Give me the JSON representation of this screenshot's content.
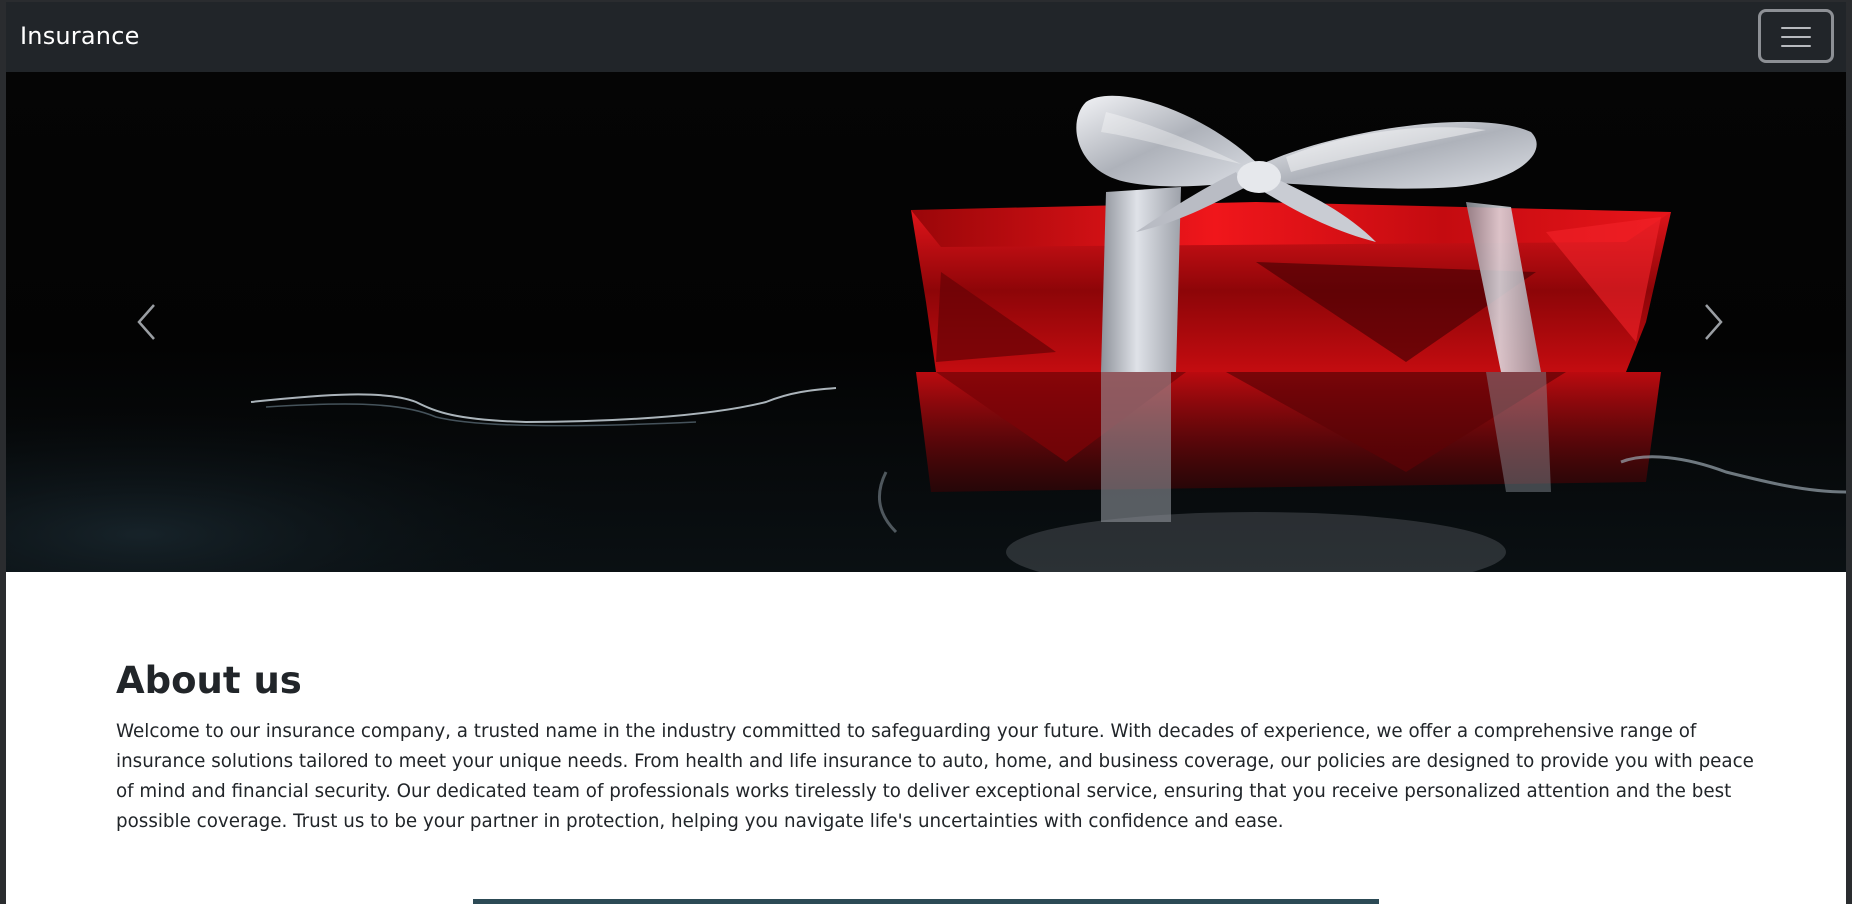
{
  "navbar": {
    "brand": "Insurance",
    "toggler_icon": "hamburger-menu-icon"
  },
  "carousel": {
    "prev_icon": "chevron-left-icon",
    "next_icon": "chevron-right-icon",
    "slide_image": "red-gift-box-silver-ribbon"
  },
  "about": {
    "heading": "About us",
    "body": "Welcome to our insurance company, a trusted name in the industry committed to safeguarding your future. With decades of experience, we offer a comprehensive range of insurance solutions tailored to meet your unique needs. From health and life insurance to auto, home, and business coverage, our policies are designed to provide you with peace of mind and financial security. Our dedicated team of professionals works tirelessly to deliver exceptional service, ensuring that you receive personalized attention and the best possible coverage. Trust us to be your partner in protection, helping you navigate life's uncertainties with confidence and ease."
  },
  "colors": {
    "navbar_bg": "#212529",
    "text": "#212529",
    "gift_red": "#d40f14",
    "ribbon_silver": "#c9ccd3"
  }
}
